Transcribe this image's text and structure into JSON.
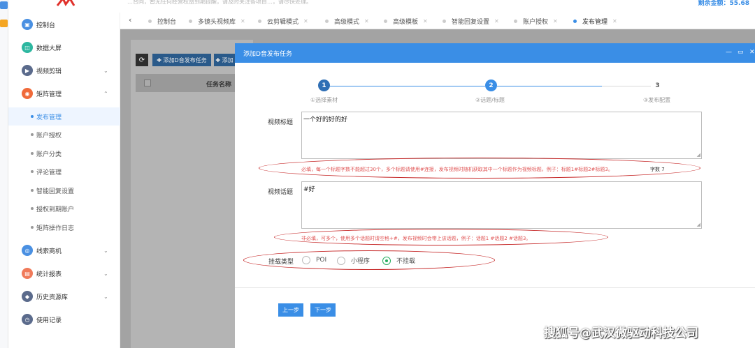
{
  "topbar": {
    "marquee": "…合同，暂无任何经营权益到期提醒，请及时关注各项目…，请尽快处理。",
    "balance": "剩余金额：55.68"
  },
  "sidebar": {
    "items": [
      {
        "label": "控制台",
        "icon": "dashboard-icon",
        "color": "#4a90e2"
      },
      {
        "label": "数据大屏",
        "icon": "screen-icon",
        "color": "#2db7a0"
      },
      {
        "label": "视频剪辑",
        "icon": "video-edit-icon",
        "color": "#5b6b8c",
        "chevron": "down"
      },
      {
        "label": "矩阵管理",
        "icon": "matrix-icon",
        "color": "#f06a3a",
        "chevron": "up"
      }
    ],
    "sub_items": [
      {
        "label": "发布管理",
        "active": true
      },
      {
        "label": "账户授权"
      },
      {
        "label": "账户分类"
      },
      {
        "label": "评论管理"
      },
      {
        "label": "智能回复设置"
      },
      {
        "label": "授权到期账户"
      },
      {
        "label": "矩阵操作日志"
      }
    ],
    "items_bottom": [
      {
        "label": "线索商机",
        "icon": "lead-icon",
        "color": "#4a90e2",
        "chevron": "down"
      },
      {
        "label": "统计报表",
        "icon": "report-icon",
        "color": "#f07a5a",
        "chevron": "down"
      },
      {
        "label": "历史资源库",
        "icon": "archive-icon",
        "color": "#5b6b8c",
        "chevron": "down"
      },
      {
        "label": "使用记录",
        "icon": "history-icon",
        "color": "#5b6b8c"
      }
    ]
  },
  "tabs": [
    {
      "label": "控制台"
    },
    {
      "label": "多镜头视频库"
    },
    {
      "label": "云剪辑模式"
    },
    {
      "label": "高级模式"
    },
    {
      "label": "高级模板"
    },
    {
      "label": "智能回复设置"
    },
    {
      "label": "账户授权"
    },
    {
      "label": "发布管理",
      "active": true
    }
  ],
  "toolbar": {
    "refresh": "⟳",
    "add_task": "✚ 添加D音发布任务",
    "add_task2": "✚ 添加"
  },
  "table": {
    "col_task_name": "任务名称"
  },
  "modal": {
    "title": "添加D音发布任务",
    "controls": {
      "minimize": "—",
      "maximize": "▭",
      "close": "✕"
    },
    "steps": [
      {
        "number": "1",
        "label": "①选择素材"
      },
      {
        "number": "2",
        "label": "②话题/标题"
      },
      {
        "number": "3",
        "label": "③发布配置"
      }
    ],
    "title_field": {
      "label": "视频标题",
      "value": "一个好的好的好",
      "hint": "必填，每一个标题字数不能超过30个，多个标题请使用#连接，发布视频时随机获取其中一个标题作为视频标题，例子：标题1#标题2#标题3。",
      "counter": "字数 7"
    },
    "topic_field": {
      "label": "视频话题",
      "value": "#好",
      "hint": "非必填，可多个，使用多个话题时请空格+#，发布视频时会带上该话题，例子：话题1 #话题2 #话题3。"
    },
    "mount_type": {
      "label": "挂载类型",
      "options": [
        "POI",
        "小程序",
        "不挂载"
      ],
      "selected": "不挂载"
    },
    "prev_button": "上一步",
    "next_button": "下一步"
  },
  "watermark": "搜狐号@武汉微驱动科技公司"
}
